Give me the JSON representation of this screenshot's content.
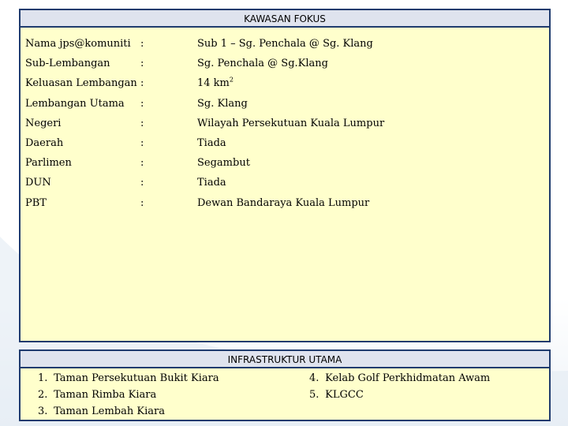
{
  "fokus": {
    "title": "KAWASAN FOKUS",
    "rows": [
      {
        "label": "Nama jps@komuniti",
        "sep": ":",
        "value": "Sub 1 – Sg. Penchala @ Sg. Klang"
      },
      {
        "label": "Sub-Lembangan",
        "sep": ":",
        "value": "Sg. Penchala @ Sg.Klang"
      },
      {
        "label": "Keluasan Lembangan",
        "sep": ":",
        "value": "14 km",
        "sup": "2"
      },
      {
        "label": "Lembangan Utama",
        "sep": ":",
        "value": "Sg. Klang"
      },
      {
        "label": "Negeri",
        "sep": ":",
        "value": "Wilayah Persekutuan Kuala Lumpur"
      },
      {
        "label": "Daerah",
        "sep": ":",
        "value": "Tiada"
      },
      {
        "label": "Parlimen",
        "sep": ":",
        "value": "Segambut"
      },
      {
        "label": "DUN",
        "sep": ":",
        "value": "Tiada"
      },
      {
        "label": "PBT",
        "sep": ":",
        "value": "Dewan Bandaraya Kuala Lumpur"
      }
    ]
  },
  "infra": {
    "title": "INFRASTRUKTUR UTAMA",
    "left_items": [
      {
        "num": "1.",
        "text": "Taman Persekutuan Bukit Kiara"
      },
      {
        "num": "2.",
        "text": "Taman Rimba Kiara"
      },
      {
        "num": "3.",
        "text": "Taman Lembah Kiara"
      }
    ],
    "right_items": [
      {
        "num": "4.",
        "text": "Kelab Golf Perkhidmatan Awam"
      },
      {
        "num": "5.",
        "text": "KLGCC"
      }
    ]
  }
}
